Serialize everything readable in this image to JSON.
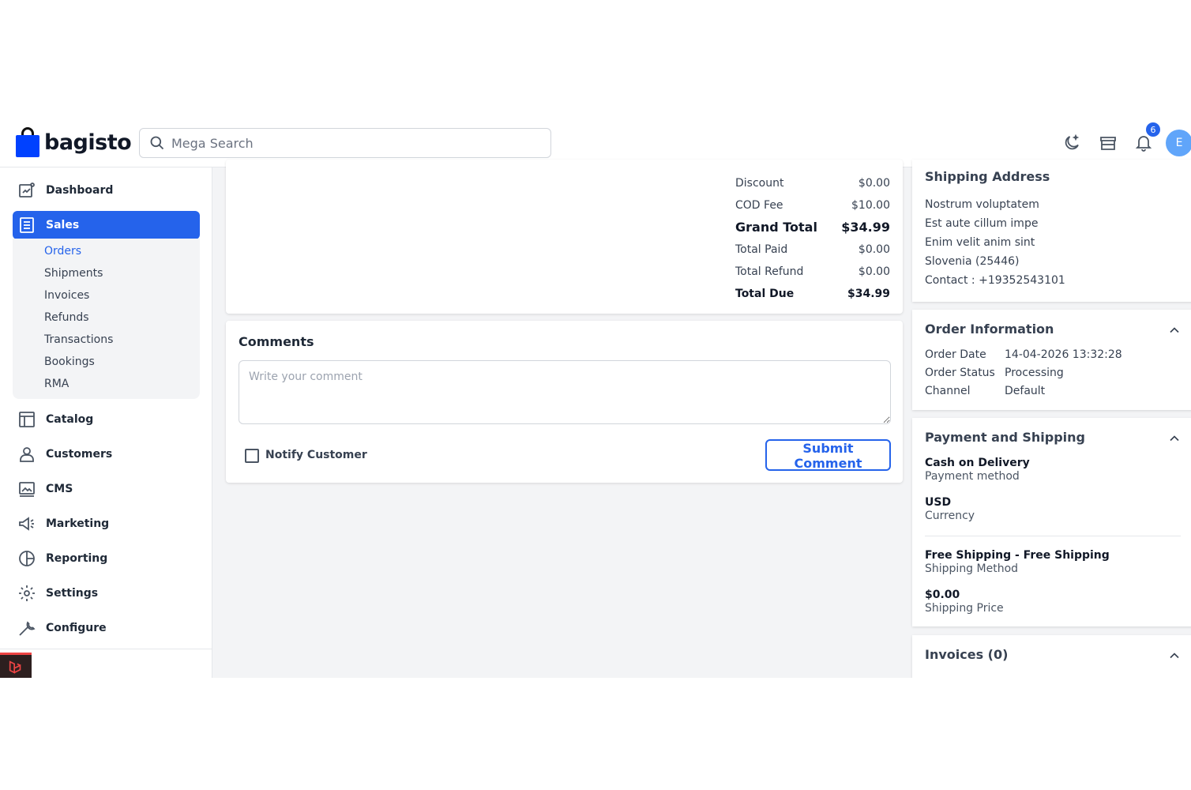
{
  "brand": {
    "name": "bagisto"
  },
  "header": {
    "search_placeholder": "Mega Search",
    "notification_count": "6",
    "avatar_initial": "E"
  },
  "sidebar": {
    "items": [
      {
        "label": "Dashboard",
        "icon": "dashboard-icon"
      },
      {
        "label": "Sales",
        "icon": "sales-icon",
        "active": true
      },
      {
        "label": "Catalog",
        "icon": "catalog-icon"
      },
      {
        "label": "Customers",
        "icon": "customers-icon"
      },
      {
        "label": "CMS",
        "icon": "cms-icon"
      },
      {
        "label": "Marketing",
        "icon": "marketing-icon"
      },
      {
        "label": "Reporting",
        "icon": "reporting-icon"
      },
      {
        "label": "Settings",
        "icon": "settings-icon"
      },
      {
        "label": "Configure",
        "icon": "configure-icon"
      }
    ],
    "sales_submenu": [
      "Orders",
      "Shipments",
      "Invoices",
      "Refunds",
      "Transactions",
      "Bookings",
      "RMA"
    ]
  },
  "summary": {
    "discount_label": "Discount",
    "discount_value": "$0.00",
    "cod_label": "COD Fee",
    "cod_value": "$10.00",
    "grand_total_label": "Grand Total",
    "grand_total_value": "$34.99",
    "total_paid_label": "Total Paid",
    "total_paid_value": "$0.00",
    "total_refund_label": "Total Refund",
    "total_refund_value": "$0.00",
    "total_due_label": "Total Due",
    "total_due_value": "$34.99"
  },
  "comments": {
    "title": "Comments",
    "placeholder": "Write your comment",
    "notify_label": "Notify Customer",
    "submit_label": "Submit Comment"
  },
  "shipping_address": {
    "title": "Shipping Address",
    "lines": [
      "Nostrum voluptatem",
      "Est aute cillum impe",
      "Enim velit anim sint",
      "Slovenia (25446)",
      "Contact : +19352543101"
    ]
  },
  "order_info": {
    "title": "Order Information",
    "date_label": "Order Date",
    "date_value": "14-04-2026 13:32:28",
    "status_label": "Order Status",
    "status_value": "Processing",
    "channel_label": "Channel",
    "channel_value": "Default"
  },
  "payment_shipping": {
    "title": "Payment and Shipping",
    "payment_method": "Cash on Delivery",
    "payment_method_label": "Payment method",
    "currency": "USD",
    "currency_label": "Currency",
    "shipping_method": "Free Shipping - Free Shipping",
    "shipping_method_label": "Shipping Method",
    "shipping_price": "$0.00",
    "shipping_price_label": "Shipping Price"
  },
  "invoices": {
    "title": "Invoices (0)"
  },
  "colors": {
    "primary": "#2563eb",
    "brand_blue": "#0041ff"
  }
}
